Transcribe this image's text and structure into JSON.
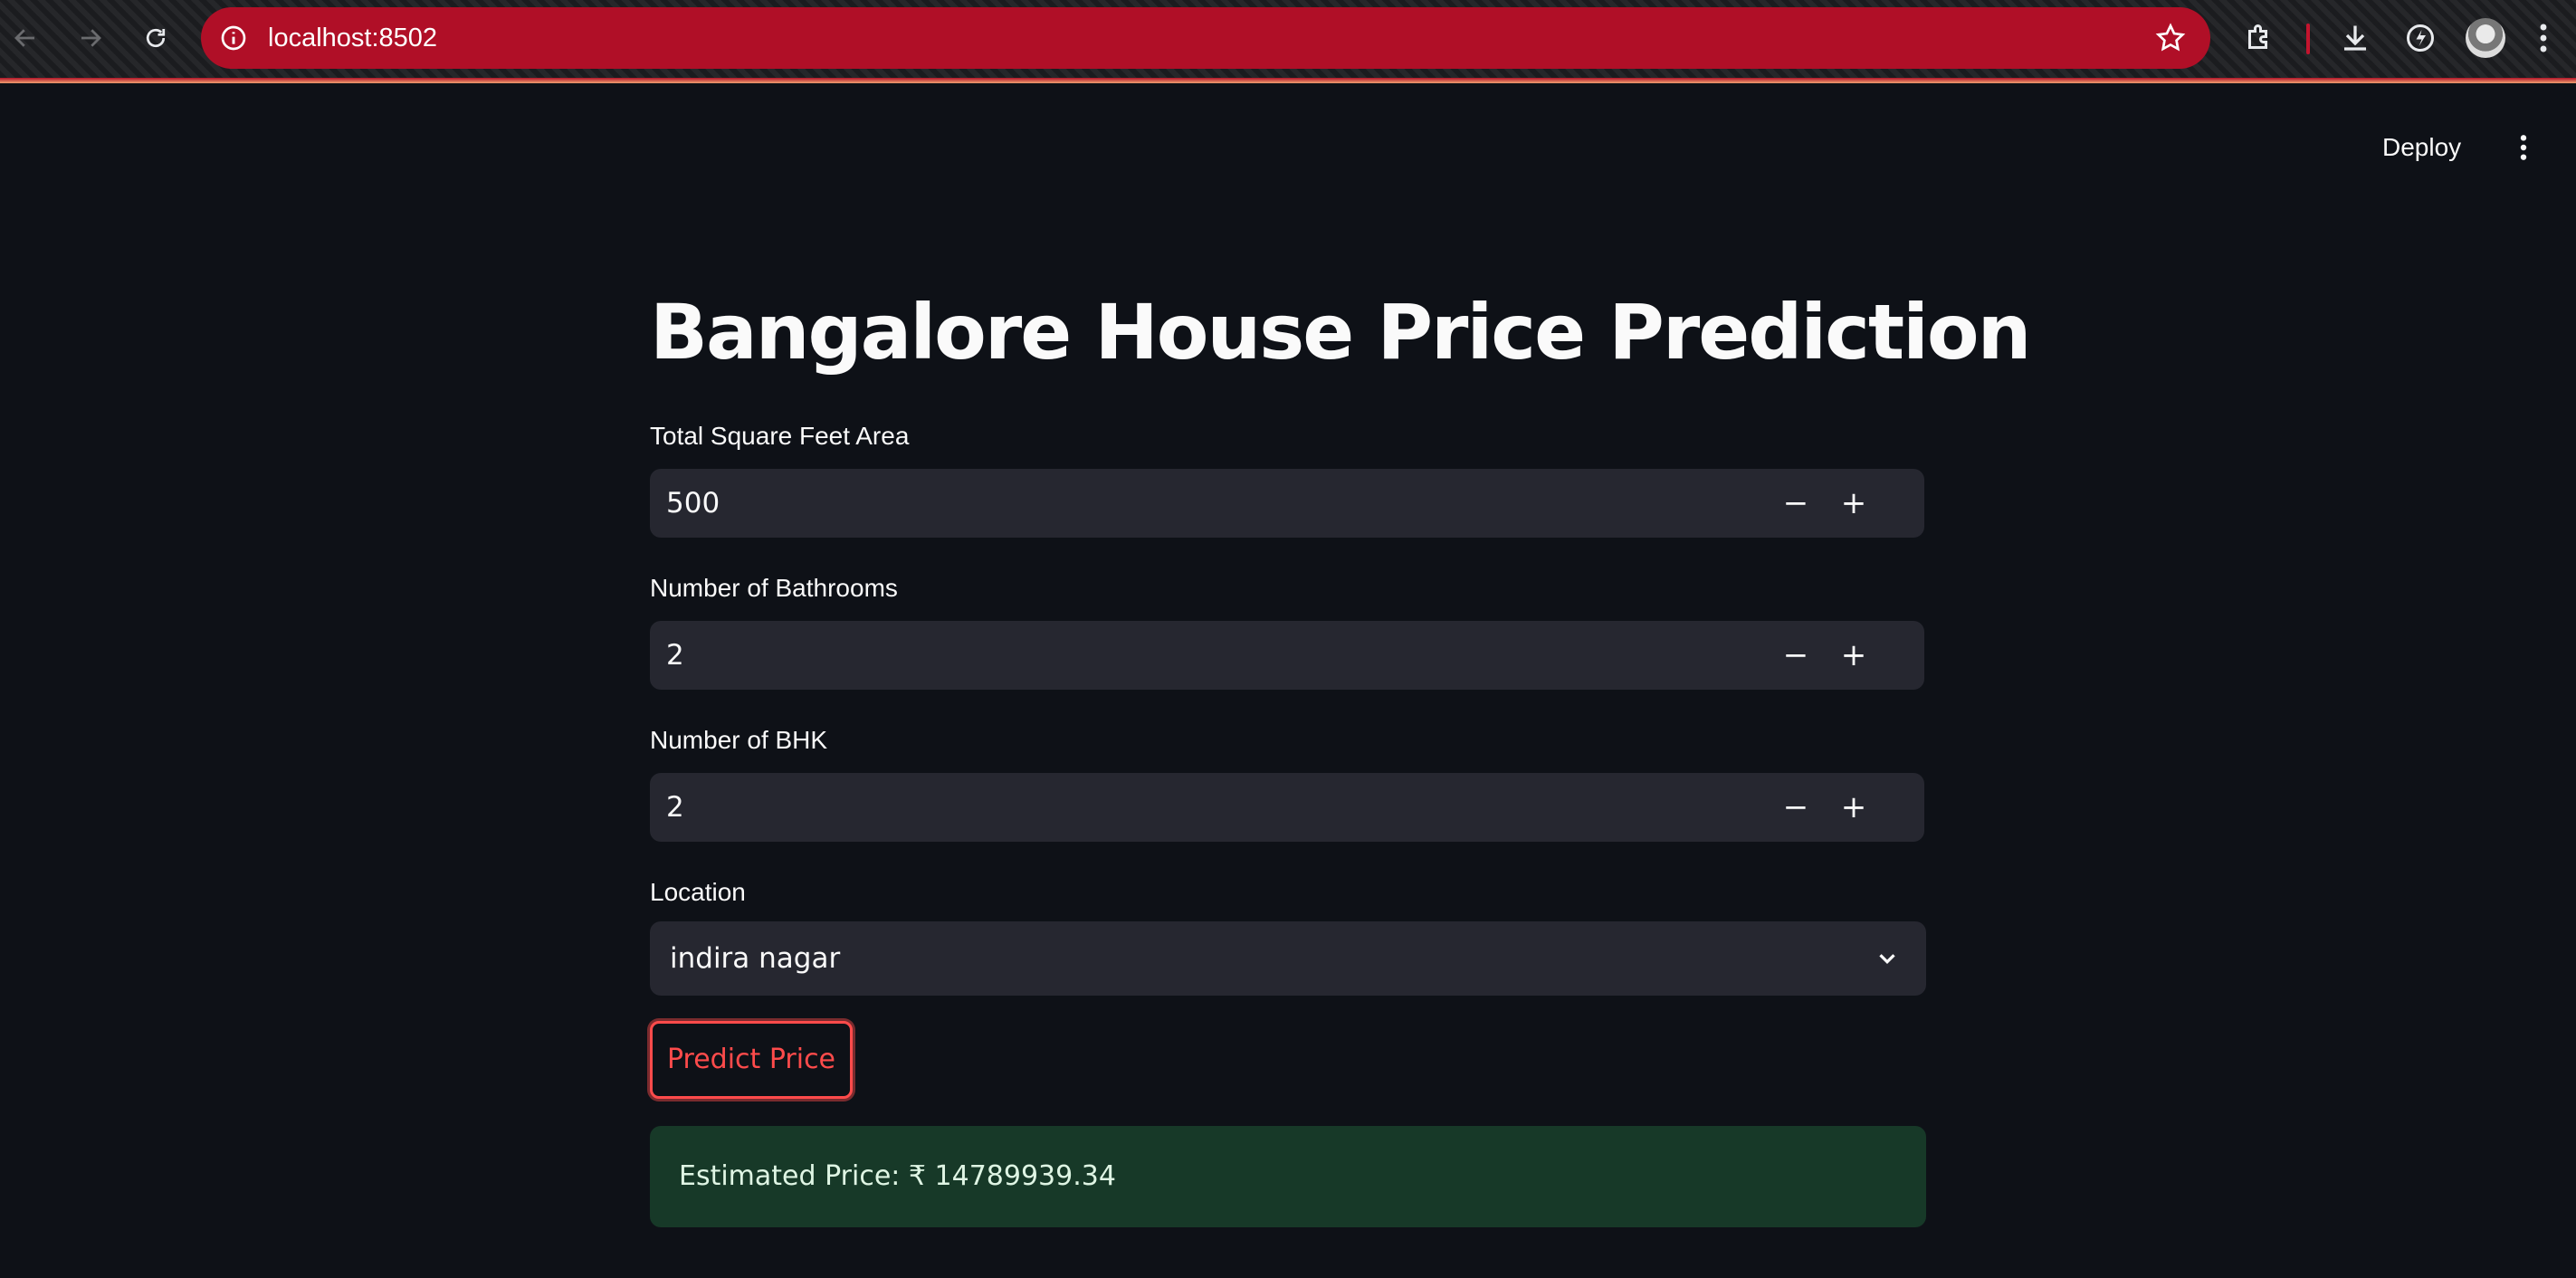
{
  "browser": {
    "url": "localhost:8502",
    "icons": {
      "back": "arrow-left-icon",
      "forward": "arrow-right-icon",
      "reload": "reload-icon",
      "site_info": "info-icon",
      "bookmark": "star-icon",
      "extensions": "puzzle-icon",
      "downloads": "download-icon",
      "performance": "bolt-icon",
      "menu": "kebab-icon"
    },
    "omnibox_color": "#b00f27"
  },
  "header": {
    "deploy_label": "Deploy"
  },
  "app": {
    "title": "Bangalore House Price Prediction",
    "fields": [
      {
        "label": "Total Square Feet Area",
        "value": "500"
      },
      {
        "label": "Number of Bathrooms",
        "value": "2"
      },
      {
        "label": "Number of BHK",
        "value": "2"
      }
    ],
    "stepper": {
      "minus": "−",
      "plus": "+"
    },
    "location": {
      "label": "Location",
      "selected": "indira nagar"
    },
    "predict_button": "Predict Price",
    "result": "Estimated Price: ₹ 14789939.34"
  },
  "colors": {
    "background": "#0e1117",
    "input_bg": "#262730",
    "accent": "#ff4b4b",
    "success_bg": "#173928"
  }
}
